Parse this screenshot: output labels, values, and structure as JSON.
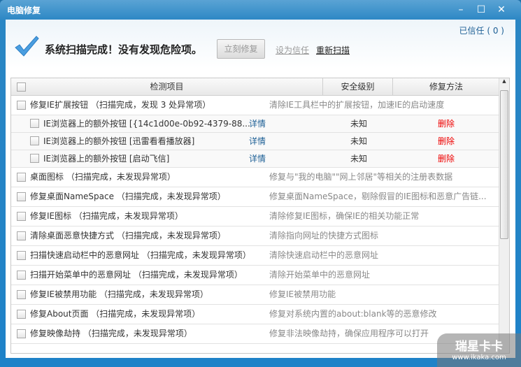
{
  "window": {
    "title": "电脑修复",
    "min": "–",
    "max": "☐",
    "close": "✕"
  },
  "trusted": "已信任 ( 0 )",
  "headline": "系统扫描完成！没有发现危险项。",
  "buttons": {
    "fix_now": "立刻修复",
    "set_trust": "设为信任",
    "rescan": "重新扫描"
  },
  "columns": [
    "检测项目",
    "安全级别",
    "修复方法"
  ],
  "group": {
    "name": "修复IE扩展按钮 （扫描完成，发现 3 处异常项）",
    "desc": "清除IE工具栏中的扩展按钮，加速IE的启动速度",
    "items": [
      {
        "name": "IE浏览器上的额外按钮 [{14c1d00e-0b92-4379-88...",
        "detail": "详情",
        "level": "未知",
        "action": "删除"
      },
      {
        "name": "IE浏览器上的额外按钮 [迅雷看看播放器]",
        "detail": "详情",
        "level": "未知",
        "action": "删除"
      },
      {
        "name": "IE浏览器上的额外按钮 [启动飞信]",
        "detail": "详情",
        "level": "未知",
        "action": "删除"
      }
    ]
  },
  "rows": [
    {
      "name": "桌面图标 （扫描完成，未发现异常项）",
      "desc": "修复与\"我的电脑\"\"网上邻居\"等相关的注册表数据"
    },
    {
      "name": "修复桌面NameSpace （扫描完成，未发现异常项）",
      "desc": "修复桌面NameSpace，剔除假冒的IE图标和恶意广告链..."
    },
    {
      "name": "修复IE图标 （扫描完成，未发现异常项）",
      "desc": "清除修复IE图标，确保IE的相关功能正常"
    },
    {
      "name": "清除桌面恶意快捷方式 （扫描完成，未发现异常项）",
      "desc": "清除指向网址的快捷方式图标"
    },
    {
      "name": "扫描快速启动栏中的恶意网址 （扫描完成，未发现异常项）",
      "desc": "清除快速启动栏中的恶意网址"
    },
    {
      "name": "扫描开始菜单中的恶意网址 （扫描完成，未发现异常项）",
      "desc": "清除开始菜单中的恶意网址"
    },
    {
      "name": "修复IE被禁用功能 （扫描完成，未发现异常项）",
      "desc": "修复IE被禁用功能"
    },
    {
      "name": "修复About页面 （扫描完成，未发现异常项）",
      "desc": "修复对系统内置的about:blank等的恶意修改"
    },
    {
      "name": "修复映像劫持 （扫描完成，未发现异常项）",
      "desc": "修复非法映像劫持，确保应用程序可以打开"
    }
  ],
  "watermark": {
    "brand": "瑞星卡卡",
    "url": "www.ikaka.com"
  },
  "colors": {
    "frame": "#2a86c4",
    "link": "#1d5f95",
    "delete": "#e00000"
  }
}
